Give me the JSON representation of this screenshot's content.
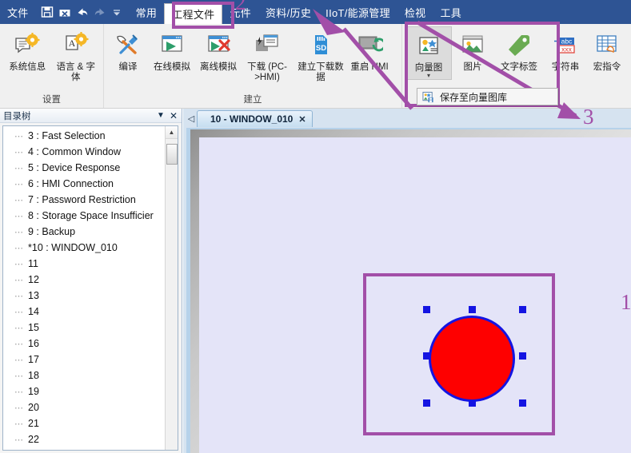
{
  "menubar": {
    "items": [
      {
        "label": "文件",
        "active": false
      },
      {
        "label": "常用",
        "active": false
      },
      {
        "label": "工程文件",
        "active": true
      },
      {
        "label": "元件",
        "active": false
      },
      {
        "label": "资料/历史",
        "active": false
      },
      {
        "label": "IIoT/能源管理",
        "active": false
      },
      {
        "label": "检视",
        "active": false
      },
      {
        "label": "工具",
        "active": false
      }
    ],
    "quick_access": [
      {
        "icon": "save-icon"
      },
      {
        "icon": "save-close-icon"
      },
      {
        "icon": "undo-icon"
      },
      {
        "icon": "redo-icon"
      },
      {
        "icon": "customize-caret-icon"
      }
    ]
  },
  "ribbon": {
    "groups": [
      {
        "label": "设置",
        "buttons": [
          {
            "label": "系统信息",
            "icon": "system-info-icon"
          },
          {
            "label": "语言 & 字体",
            "icon": "language-font-icon"
          }
        ]
      },
      {
        "label": "建立",
        "buttons": [
          {
            "label": "编译",
            "icon": "compile-icon"
          },
          {
            "label": "在线模拟",
            "icon": "online-simulation-icon"
          },
          {
            "label": "离线模拟",
            "icon": "offline-simulation-icon"
          },
          {
            "label": "下载 (PC->HMI)",
            "icon": "download-pc-to-hmi-icon"
          },
          {
            "label": "建立下载数据",
            "icon": "sd-card-icon"
          },
          {
            "label": "重启 HMI",
            "icon": "restart-hmi-icon"
          }
        ]
      },
      {
        "label": "",
        "buttons": [
          {
            "label": "向量图",
            "icon": "vector-graphic-icon",
            "selected": true,
            "has_caret": true
          },
          {
            "label": "图片",
            "icon": "picture-icon"
          },
          {
            "label": "文字标签",
            "icon": "text-label-icon"
          },
          {
            "label": "字符串",
            "icon": "string-icon"
          },
          {
            "label": "宏指令",
            "icon": "macro-icon"
          }
        ]
      }
    ],
    "dropdown": {
      "item_label": "保存至向量图库",
      "icon": "save-to-vector-library-icon"
    }
  },
  "sidebar": {
    "title": "目录树",
    "header_buttons": [
      {
        "icon": "chevron-down-icon"
      },
      {
        "icon": "close-icon"
      }
    ],
    "tree_items": [
      "3 : Fast Selection",
      "4 : Common Window",
      "5 : Device Response",
      "6 : HMI Connection",
      "7 : Password Restriction",
      "8 : Storage Space Insufficier",
      "9 : Backup",
      "*10 : WINDOW_010",
      "11",
      "12",
      "13",
      "14",
      "15",
      "16",
      "17",
      "18",
      "19",
      "20",
      "21",
      "22"
    ]
  },
  "document": {
    "tab_nav_icon": "prev-tab-icon",
    "tabs": [
      {
        "label": "10 - WINDOW_010",
        "close_label": "✕",
        "active": true
      }
    ]
  },
  "canvas": {
    "shape": {
      "name": "circle",
      "fill_color": "#FE0000",
      "stroke_color": "#1414E2",
      "selected": true,
      "handle_count": 8
    },
    "page_color": "#E4E4F8"
  },
  "annotations": {
    "color": "#A24FA8",
    "markers": [
      {
        "number": "1",
        "kind": "rect-callout"
      },
      {
        "number": "2",
        "kind": "tab-highlight"
      },
      {
        "number": "3",
        "kind": "menu-highlight"
      }
    ]
  }
}
